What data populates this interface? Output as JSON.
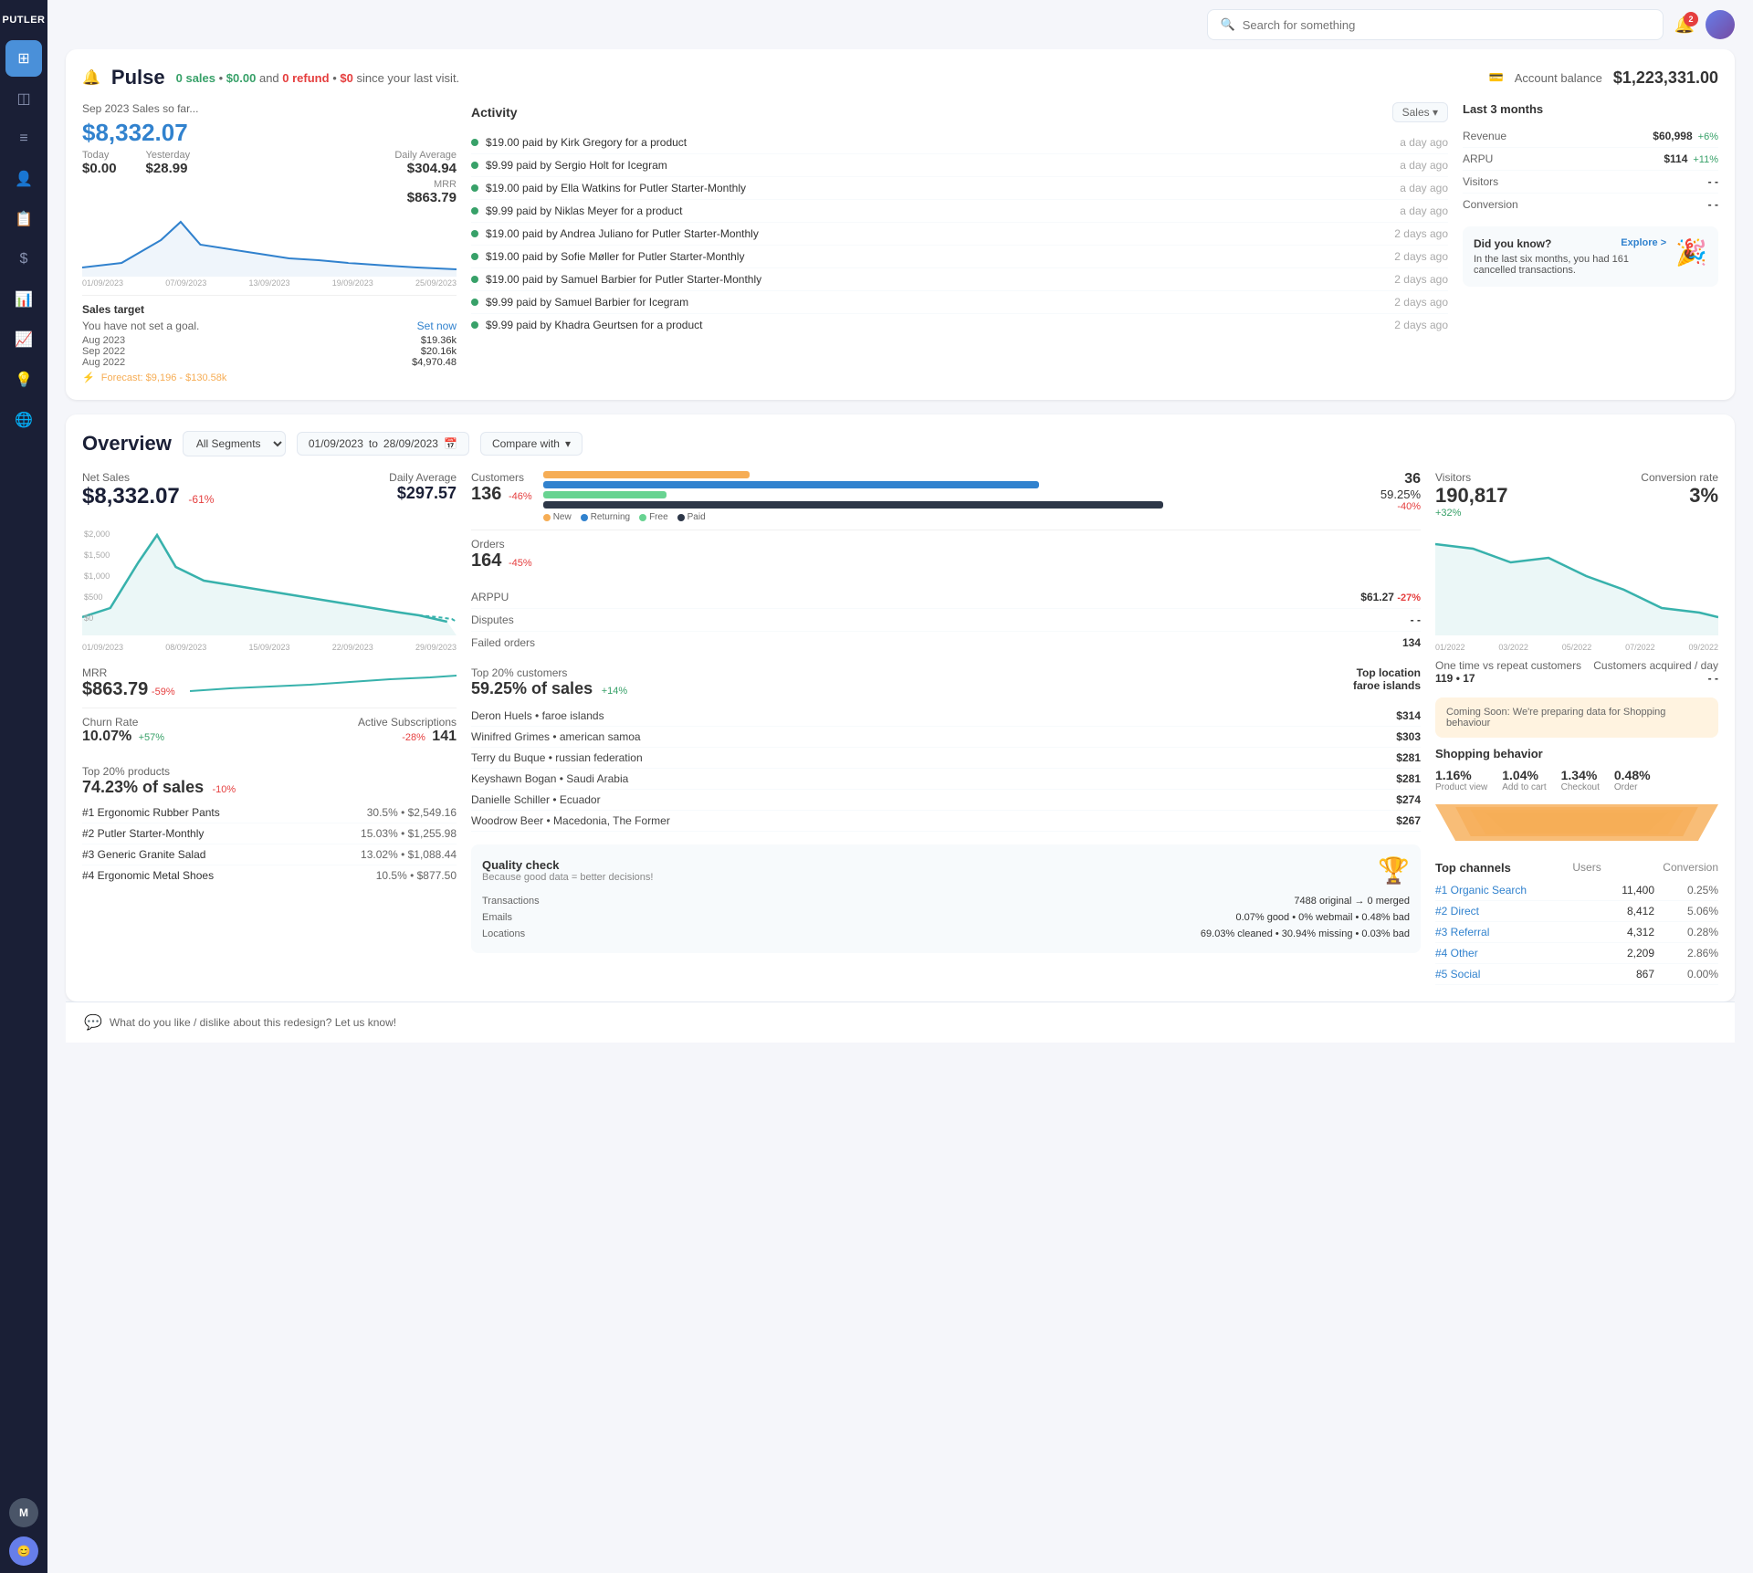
{
  "app": {
    "name": "PUTLER"
  },
  "topbar": {
    "search_placeholder": "Search for something",
    "bell_badge": "2"
  },
  "sidebar": {
    "items": [
      {
        "id": "dashboard",
        "icon": "⊞",
        "active": true
      },
      {
        "id": "analytics",
        "icon": "◫"
      },
      {
        "id": "reports",
        "icon": "≡"
      },
      {
        "id": "customers",
        "icon": "👤"
      },
      {
        "id": "orders",
        "icon": "📋"
      },
      {
        "id": "payments",
        "icon": "$"
      },
      {
        "id": "charts",
        "icon": "📊"
      },
      {
        "id": "trends",
        "icon": "📈"
      },
      {
        "id": "insights",
        "icon": "💡"
      },
      {
        "id": "globe",
        "icon": "🌐"
      },
      {
        "id": "avatar-m",
        "icon": "M"
      },
      {
        "id": "avatar-user",
        "icon": "😊"
      }
    ]
  },
  "pulse": {
    "title": "Pulse",
    "subtitle_pre": "0 sales",
    "subtitle_dot": "•",
    "subtitle_amount": "$0.00",
    "subtitle_and": "and",
    "subtitle_refund": "0 refund",
    "subtitle_dot2": "•",
    "subtitle_refund_amt": "$0",
    "subtitle_post": "since your last visit.",
    "account_balance_label": "Account balance",
    "account_balance_value": "$1,223,331.00"
  },
  "sales": {
    "period": "Sep 2023 Sales so far...",
    "amount": "$8,332.07",
    "today_label": "Today",
    "today_val": "$0.00",
    "yesterday_label": "Yesterday",
    "yesterday_val": "$28.99",
    "daily_avg_label": "Daily Average",
    "daily_avg_val": "$304.94",
    "mrr_label": "MRR",
    "mrr_val": "$863.79"
  },
  "sales_target": {
    "title": "Sales target",
    "subtitle": "You have not set a goal.",
    "set_now": "Set now",
    "rows": [
      {
        "period": "Aug 2023",
        "amount": "$19.36k"
      },
      {
        "period": "Sep 2022",
        "amount": "$20.16k"
      },
      {
        "period": "Aug 2022",
        "amount": "$4,970.48"
      }
    ],
    "forecast": "Forecast: $9,196 - $130.58k"
  },
  "activity": {
    "title": "Activity",
    "filter": "Sales ▾",
    "items": [
      {
        "text": "$19.00 paid by Kirk Gregory for a product",
        "time": "a day ago"
      },
      {
        "text": "$9.99 paid by Sergio Holt for Icegram",
        "time": "a day ago"
      },
      {
        "text": "$19.00 paid by Ella Watkins for Putler Starter-Monthly",
        "time": "a day ago"
      },
      {
        "text": "$9.99 paid by Niklas Meyer for a product",
        "time": "a day ago"
      },
      {
        "text": "$19.00 paid by Andrea Juliano for Putler Starter-Monthly",
        "time": "2 days ago"
      },
      {
        "text": "$19.00 paid by Sofie Møller for Putler Starter-Monthly",
        "time": "2 days ago"
      },
      {
        "text": "$19.00 paid by Samuel Barbier for Putler Starter-Monthly",
        "time": "2 days ago"
      },
      {
        "text": "$9.99 paid by Samuel Barbier for Icegram",
        "time": "2 days ago"
      },
      {
        "text": "$9.99 paid by Khadra Geurtsen for a product",
        "time": "2 days ago"
      }
    ]
  },
  "last3months": {
    "title": "Last 3 months",
    "rows": [
      {
        "label": "Revenue",
        "value": "$60,998",
        "change": "+6%",
        "pos": true
      },
      {
        "label": "ARPU",
        "value": "$114",
        "change": "+11%",
        "pos": true
      },
      {
        "label": "Visitors",
        "value": "- -",
        "change": "",
        "pos": null
      },
      {
        "label": "Conversion",
        "value": "- -",
        "change": "",
        "pos": null
      }
    ]
  },
  "did_you_know": {
    "title": "Did you know?",
    "explore": "Explore >",
    "text": "In the last six months, you had 161 cancelled transactions."
  },
  "overview": {
    "title": "Overview",
    "segment": "All Segments",
    "date_from": "01/09/2023",
    "date_to": "28/09/2023",
    "compare_with": "Compare with"
  },
  "net_sales": {
    "label": "Net Sales",
    "value": "$8,332.07",
    "change": "-61%",
    "daily_avg_label": "Daily Average",
    "daily_avg_val": "$297.57",
    "x_labels": [
      "01/09/2023",
      "08/09/2023",
      "15/09/2023",
      "22/09/2023",
      "29/09/2023"
    ]
  },
  "mrr_overview": {
    "label": "MRR",
    "value": "$863.79",
    "change": "-59%"
  },
  "churn": {
    "label": "Churn Rate",
    "value": "10.07%",
    "change": "+57%",
    "active_sub_label": "Active Subscriptions",
    "active_sub_change": "-28%",
    "active_sub_val": "141"
  },
  "top_products": {
    "label": "Top 20% products",
    "value": "74.23% of sales",
    "change": "-10%",
    "items": [
      {
        "rank": "#1",
        "name": "Ergonomic Rubber Pants",
        "pct": "30.5%",
        "amount": "$2,549.16"
      },
      {
        "rank": "#2",
        "name": "Putler Starter-Monthly",
        "pct": "15.03%",
        "amount": "$1,255.98"
      },
      {
        "rank": "#3",
        "name": "Generic Granite Salad",
        "pct": "13.02%",
        "amount": "$1,088.44"
      },
      {
        "rank": "#4",
        "name": "Ergonomic Metal Shoes",
        "pct": "10.5%",
        "amount": "$877.50"
      }
    ]
  },
  "customers": {
    "label": "Customers",
    "value": "136",
    "change": "-46%",
    "count2": "36",
    "pct": "59.25%",
    "pct_change": "-40%",
    "bars": [
      {
        "label": "New",
        "color": "#f6ad55",
        "pct": 20
      },
      {
        "label": "Returning",
        "color": "#3182ce",
        "pct": 55
      },
      {
        "label": "Free",
        "color": "#68d391",
        "pct": 10
      },
      {
        "label": "Paid",
        "color": "#2d3748",
        "pct": 70
      }
    ]
  },
  "orders": {
    "label": "Orders",
    "value": "164",
    "change": "-45%"
  },
  "arppu": {
    "label": "ARPPU",
    "value": "$61.27",
    "change": "-27%"
  },
  "disputes": {
    "label": "Disputes",
    "value": "- -"
  },
  "failed_orders": {
    "label": "Failed orders",
    "value": "134"
  },
  "top20customers": {
    "label": "Top 20% customers",
    "pct": "59.25% of sales",
    "pct_change": "+14%",
    "location_label": "Top location",
    "location": "faroe islands",
    "customers": [
      {
        "name": "Deron Huels • faroe islands",
        "amount": "$314"
      },
      {
        "name": "Winifred Grimes • american samoa",
        "amount": "$303"
      },
      {
        "name": "Terry du Buque • russian federation",
        "amount": "$281"
      },
      {
        "name": "Keyshawn Bogan • Saudi Arabia",
        "amount": "$281"
      },
      {
        "name": "Danielle Schiller • Ecuador",
        "amount": "$274"
      },
      {
        "name": "Woodrow Beer • Macedonia, The Former",
        "amount": "$267"
      }
    ]
  },
  "quality": {
    "title": "Quality check",
    "subtitle": "Because good data = better decisions!",
    "rows": [
      {
        "label": "Transactions",
        "value": "7488 original → 0 merged"
      },
      {
        "label": "Emails",
        "value": "0.07% good • 0% webmail • 0.48% bad"
      },
      {
        "label": "Locations",
        "value": "69.03% cleaned • 30.94% missing • 0.03% bad"
      }
    ]
  },
  "visitors": {
    "label": "Visitors",
    "value": "190,817",
    "change": "+32%",
    "conv_label": "Conversion rate",
    "conv_val": "3%",
    "x_labels": [
      "01/2022",
      "03/2022",
      "05/2022",
      "07/2022",
      "09/2022"
    ],
    "one_time_label": "One time vs repeat customers",
    "one_time_val": "119 • 17",
    "acquired_label": "Customers acquired / day",
    "acquired_val": "- -"
  },
  "shopping": {
    "coming_soon": "Coming Soon: We're preparing data for Shopping behaviour",
    "title": "Shopping behavior",
    "metrics": [
      {
        "value": "1.16%",
        "label": "Product view"
      },
      {
        "value": "1.04%",
        "label": "Add to cart"
      },
      {
        "value": "1.34%",
        "label": "Checkout"
      },
      {
        "value": "0.48%",
        "label": "Order"
      }
    ]
  },
  "channels": {
    "title": "Top channels",
    "users_label": "Users",
    "conv_label": "Conversion",
    "items": [
      {
        "rank": "#1",
        "name": "Organic Search",
        "users": "11,400",
        "conv": "0.25%"
      },
      {
        "rank": "#2",
        "name": "Direct",
        "users": "8,412",
        "conv": "5.06%"
      },
      {
        "rank": "#3",
        "name": "Referral",
        "users": "4,312",
        "conv": "0.28%"
      },
      {
        "rank": "#4",
        "name": "Other",
        "users": "2,209",
        "conv": "2.86%"
      },
      {
        "rank": "#5",
        "name": "Social",
        "users": "867",
        "conv": "0.00%"
      }
    ]
  },
  "feedback": {
    "text": "What do you like / dislike about this redesign? Let us know!"
  }
}
